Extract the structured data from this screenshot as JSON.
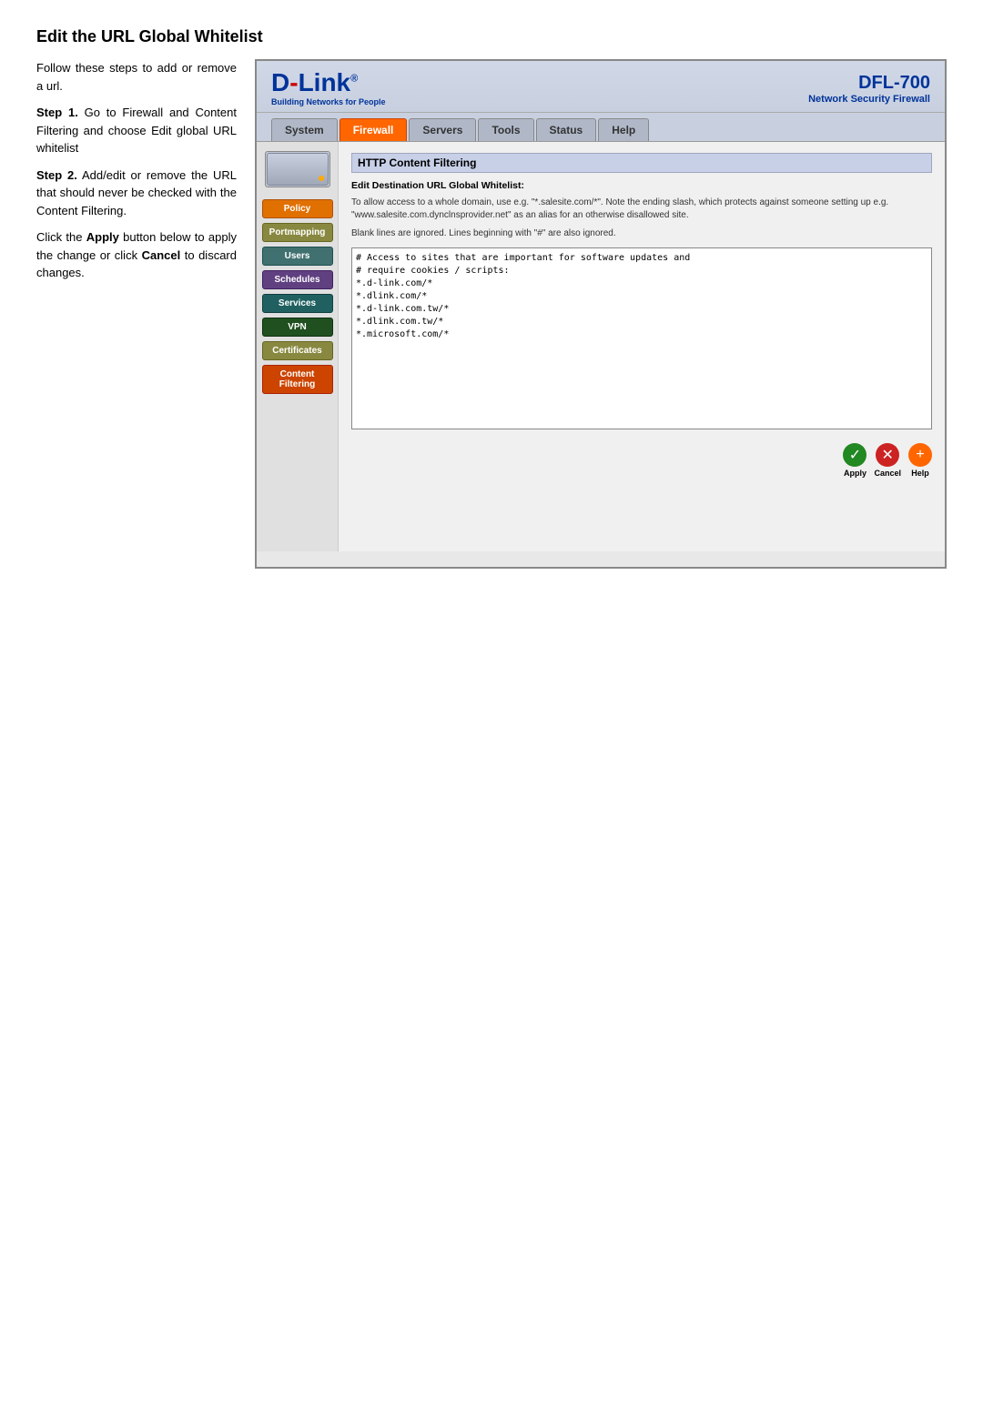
{
  "page": {
    "title": "Edit the URL Global Whitelist"
  },
  "instructions": {
    "intro": "Follow these steps to add or remove a url.",
    "step1_label": "Step  1.",
    "step1_text": "Go to Firewall and Content Filtering and choose Edit  global  URL whitelist",
    "step2_label": "Step 2.",
    "step2_text": "Add/edit or remove the URL that should  never  be checked  with  the Content Filtering.",
    "step3_text": "Click  the ",
    "step3_bold": "Apply",
    "step3_rest": " button below to apply the  change  or click ",
    "step3_cancel": "Cancel",
    "step3_end": "  to   discard changes."
  },
  "header": {
    "brand": "D-Link",
    "tagline": "Building Networks for People",
    "model": "DFL-700",
    "description": "Network Security Firewall"
  },
  "nav": {
    "tabs": [
      {
        "label": "System",
        "active": false
      },
      {
        "label": "Firewall",
        "active": true
      },
      {
        "label": "Servers",
        "active": false
      },
      {
        "label": "Tools",
        "active": false
      },
      {
        "label": "Status",
        "active": false
      },
      {
        "label": "Help",
        "active": false
      }
    ]
  },
  "sidebar": {
    "buttons": [
      {
        "label": "Policy",
        "color": "orange"
      },
      {
        "label": "Portmapping",
        "color": "olive"
      },
      {
        "label": "Users",
        "color": "teal"
      },
      {
        "label": "Schedules",
        "color": "purple"
      },
      {
        "label": "Services",
        "color": "dark-teal"
      },
      {
        "label": "VPN",
        "color": "dark-green"
      },
      {
        "label": "Certificates",
        "color": "olive"
      },
      {
        "label": "Content Filtering",
        "color": "orange-red"
      }
    ]
  },
  "content": {
    "section_title": "HTTP Content Filtering",
    "description": "Edit Destination URL Global Whitelist:",
    "note1": "To allow access to a whole domain, use e.g. \"*.salesite.com/*\". Note the ending slash, which protects against someone setting up e.g. \"www.salesite.com.dynclnsprovider.net\" as an alias for an otherwise disallowed site.",
    "note2": "Blank lines are ignored. Lines beginning with \"#\" are also ignored.",
    "textarea_content": "# Access to sites that are important for software updates and\n# require cookies / scripts:\n*.d-link.com/*\n*.dlink.com/*\n*.d-link.com.tw/*\n*.dlink.com.tw/*\n*.microsoft.com/*"
  },
  "actions": [
    {
      "label": "Apply",
      "color": "green",
      "icon": "✓"
    },
    {
      "label": "Cancel",
      "color": "red",
      "icon": "✕"
    },
    {
      "label": "Help",
      "color": "orange-icon",
      "icon": "+"
    }
  ]
}
